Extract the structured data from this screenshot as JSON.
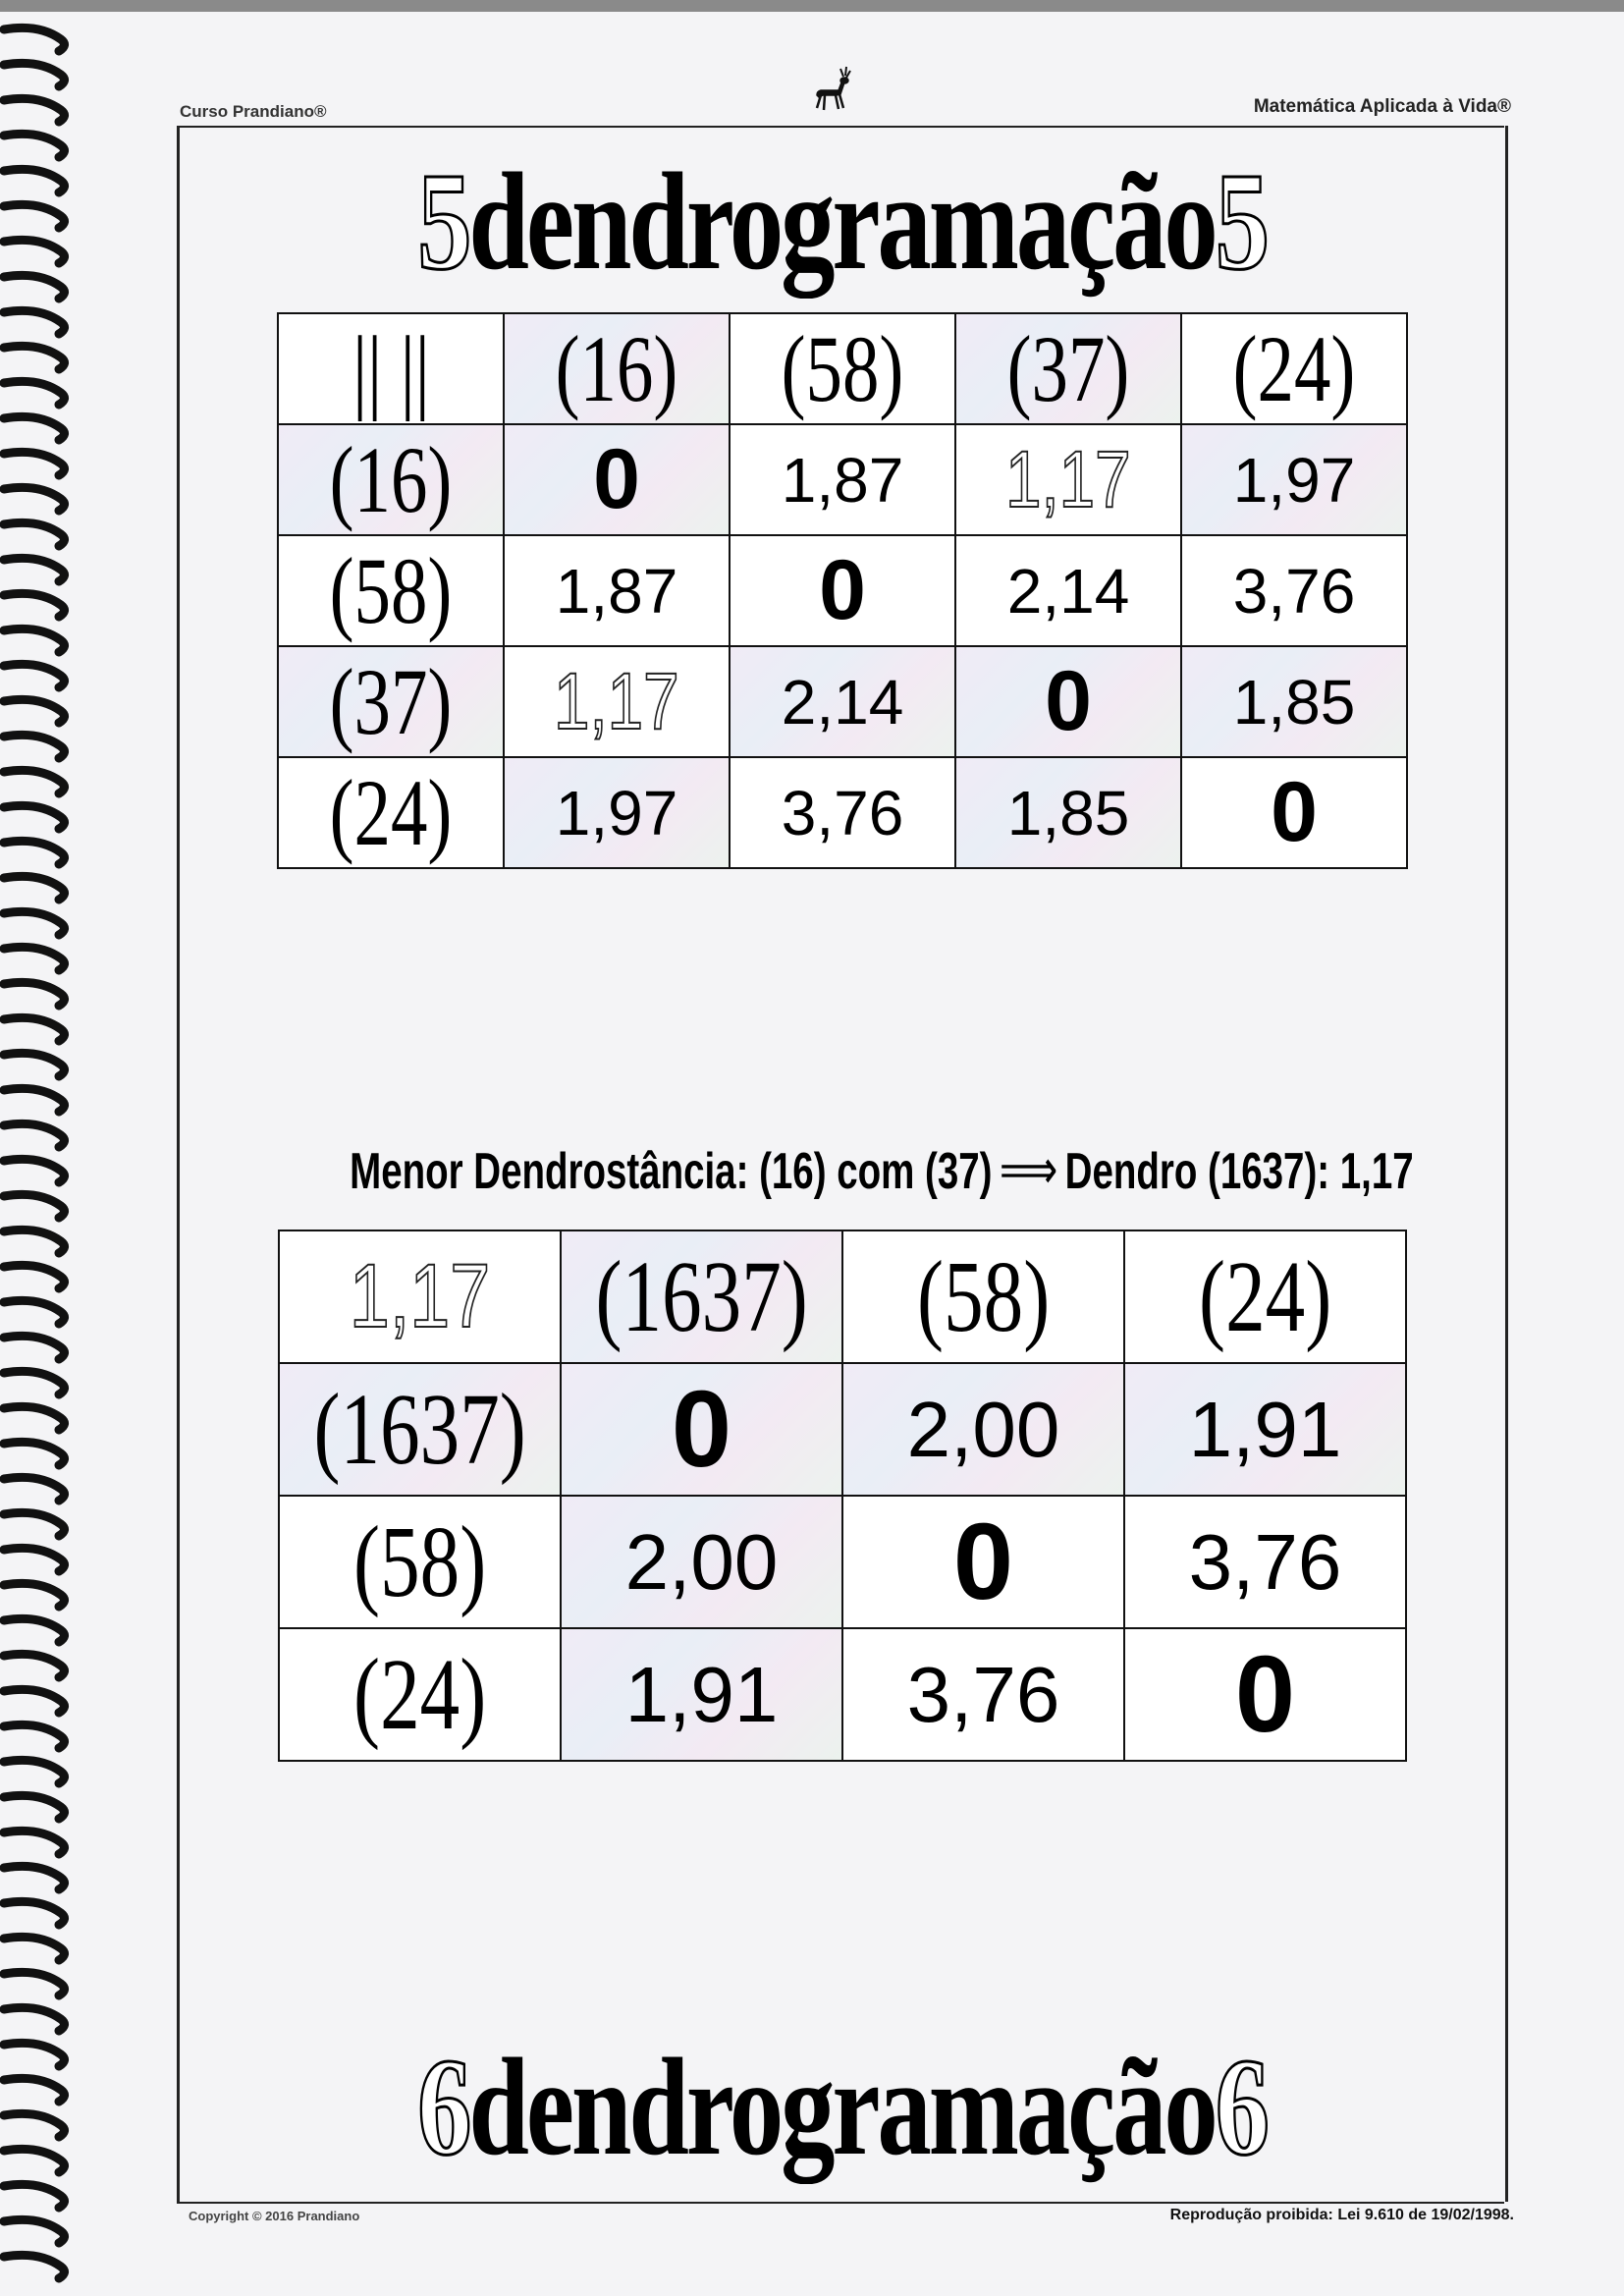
{
  "header": {
    "left": "Curso Prandiano®",
    "right": "Matemática Aplicada à Vida®"
  },
  "title_top": {
    "prefix": "5",
    "word": "dendrogramação",
    "suffix": "5"
  },
  "table1": {
    "corner": "|| ||",
    "columns": [
      "(16)",
      "(58)",
      "(37)",
      "(24)"
    ],
    "rows": [
      {
        "label": "(16)",
        "cells": [
          "0",
          "1,87",
          "1,17",
          "1,97"
        ]
      },
      {
        "label": "(58)",
        "cells": [
          "1,87",
          "0",
          "2,14",
          "3,76"
        ]
      },
      {
        "label": "(37)",
        "cells": [
          "1,17",
          "2,14",
          "0",
          "1,85"
        ]
      },
      {
        "label": "(24)",
        "cells": [
          "1,97",
          "3,76",
          "1,85",
          "0"
        ]
      }
    ]
  },
  "statement": {
    "before": "Menor Dendrostância: (16) com (37)",
    "arrow": "⟹",
    "after": "Dendro (1637): 1,17"
  },
  "table2": {
    "corner": "1,17",
    "columns": [
      "(1637)",
      "(58)",
      "(24)"
    ],
    "rows": [
      {
        "label": "(1637)",
        "cells": [
          "0",
          "2,00",
          "1,91"
        ]
      },
      {
        "label": "(58)",
        "cells": [
          "2,00",
          "0",
          "3,76"
        ]
      },
      {
        "label": "(24)",
        "cells": [
          "1,91",
          "3,76",
          "0"
        ]
      }
    ]
  },
  "title_bottom": {
    "prefix": "6",
    "word": "dendrogramação",
    "suffix": "6"
  },
  "footer": {
    "left": "Copyright © 2016 Prandiano",
    "right": "Reprodução proibida: Lei 9.610 de 19/02/1998."
  }
}
